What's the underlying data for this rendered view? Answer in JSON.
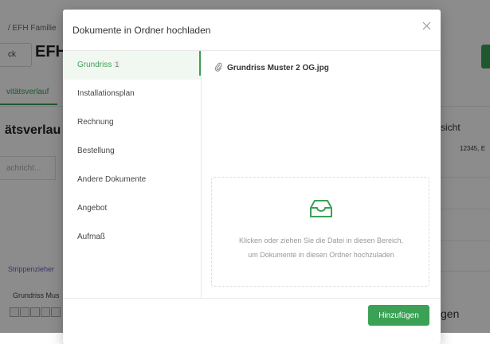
{
  "background": {
    "breadcrumb": "/ EFH Familie",
    "back_label": "ck",
    "page_title": "EFH",
    "tab_label": "vitätsverlauf",
    "section_title": "ätsverlau",
    "message_placeholder": "achricht...",
    "right_title": "sicht",
    "right_address": "12345, E",
    "strippenzieher": "Strippenzieher",
    "grundriss_item": "Grundriss Mus",
    "right_bottom": "gen"
  },
  "modal": {
    "title": "Dokumente in Ordner hochladen",
    "close_icon": "close-icon",
    "categories": [
      {
        "label": "Grundriss",
        "badge": "1",
        "active": true
      },
      {
        "label": "Installationsplan",
        "active": false
      },
      {
        "label": "Rechnung",
        "active": false
      },
      {
        "label": "Bestellung",
        "active": false
      },
      {
        "label": "Andere Dokumente",
        "active": false
      },
      {
        "label": "Angebot",
        "active": false
      },
      {
        "label": "Aufmaß",
        "active": false
      }
    ],
    "file_name": "Grundriss Muster 2 OG.jpg",
    "file_icon": "paperclip-icon",
    "dropzone_icon": "inbox-icon",
    "dropzone_text": "Klicken oder ziehen Sie die Datei in diesen Bereich, um Dokumente in diesen Ordner hochzuladen",
    "submit_label": "Hinzufügen"
  },
  "colors": {
    "accent": "#3aa155",
    "overlay": "rgba(0,0,0,0.45)",
    "link_purple": "#6a5fc7"
  }
}
